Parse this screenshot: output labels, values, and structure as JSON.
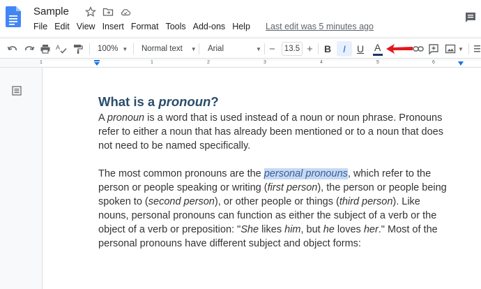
{
  "app": {
    "doc_title": "Sample",
    "menu": [
      "File",
      "Edit",
      "View",
      "Insert",
      "Format",
      "Tools",
      "Add-ons",
      "Help"
    ],
    "last_edit": "Last edit was 5 minutes ago"
  },
  "toolbar": {
    "zoom": "100%",
    "style": "Normal text",
    "font": "Arial",
    "font_size": "13.5",
    "minus": "−",
    "plus": "+",
    "bold": "B",
    "italic": "I",
    "underline": "U",
    "text_color": "A",
    "text_color_hex": "#1f3864"
  },
  "ruler": {
    "numbers": [
      "1",
      "1",
      "2",
      "3",
      "4",
      "5",
      "6"
    ]
  },
  "document": {
    "heading_pre": "What is a ",
    "heading_em": "pronoun",
    "heading_post": "?",
    "p1": {
      "l1_a": "A ",
      "l1_b": "pronoun",
      "l1_c": " is a word that is used instead of a noun or noun phrase. Pronouns",
      "l2": "refer to either a noun that has already been mentioned or to a noun that does",
      "l3": "not need to be named specifically."
    },
    "p2": {
      "l1_a": "The most common pronouns are the ",
      "l1_hl": "personal pronouns",
      "l1_c": ", which refer to the",
      "l2_a": "person or people speaking or writing (",
      "l2_b": "first person",
      "l2_c": "), the person or people being",
      "l3_a": "spoken to (",
      "l3_b": "second person",
      "l3_c": "), or other people or things (",
      "l3_d": "third person",
      "l3_e": "). Like",
      "l4": "nouns, personal pronouns can function as either the subject of a verb or the",
      "l5_a": "object of a verb or preposition: \"",
      "l5_b": "She",
      "l5_c": " likes ",
      "l5_d": "him",
      "l5_e": ", but ",
      "l5_f": "he",
      "l5_g": " loves ",
      "l5_h": "her",
      "l5_i": ".\" Most of the",
      "l6": "personal pronouns have different subject and object forms:"
    }
  },
  "colors": {
    "accent_blue": "#1a73e8",
    "docs_blue": "#4285f4",
    "highlight": "#c6d9f4",
    "arrow_red": "#e3161c"
  },
  "icons": [
    "docs-logo-icon",
    "star-icon",
    "move-to-folder-icon",
    "cloud-status-icon",
    "comment-icon",
    "undo-icon",
    "redo-icon",
    "print-icon",
    "spellcheck-icon",
    "paint-format-icon",
    "link-icon",
    "add-comment-icon",
    "insert-image-icon",
    "more-icon",
    "outline-icon",
    "red-arrow-annotation"
  ]
}
